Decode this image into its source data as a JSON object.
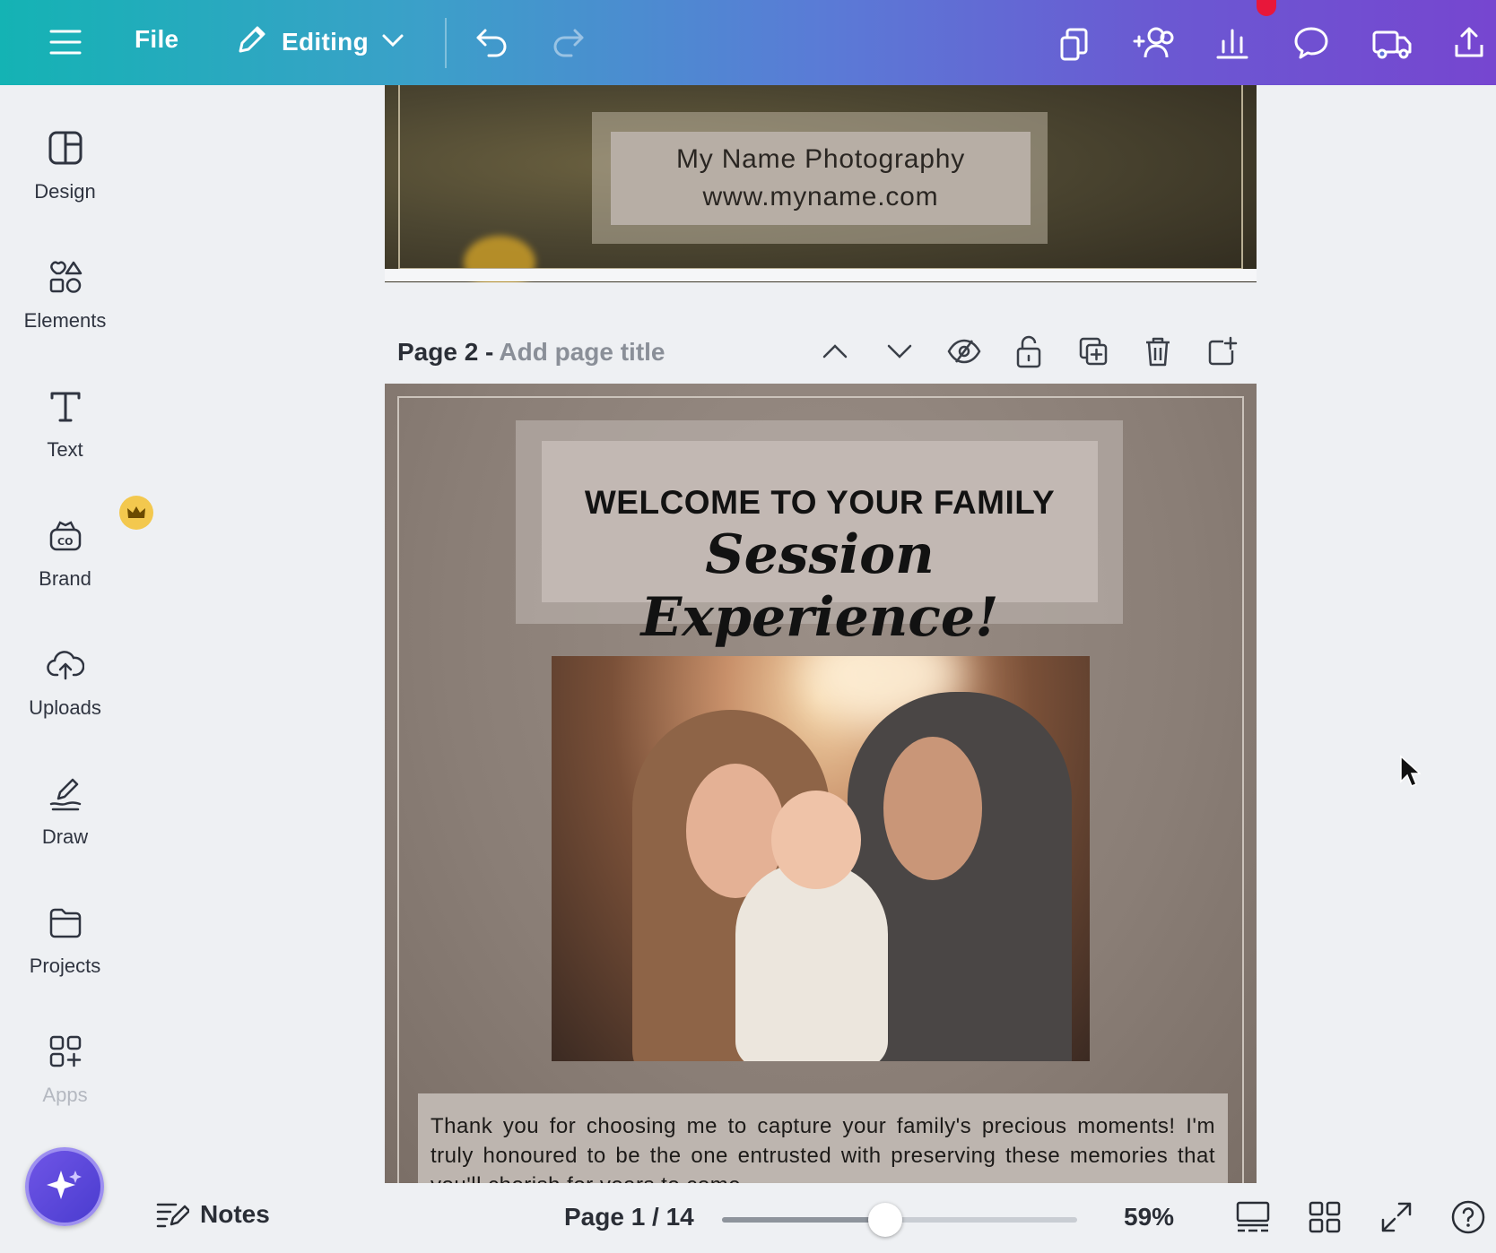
{
  "topbar": {
    "file_label": "File",
    "mode_label": "Editing",
    "icons": [
      "menu-icon",
      "pencil-icon",
      "chevron-down-icon",
      "undo-icon",
      "redo-icon",
      "resize-icon",
      "share-people-icon",
      "insights-icon",
      "comment-icon",
      "print-truck-icon",
      "upload-share-icon"
    ],
    "notification_color": "#e8173a"
  },
  "sidebar": {
    "items": [
      {
        "label": "Design",
        "icon": "design-icon"
      },
      {
        "label": "Elements",
        "icon": "elements-icon"
      },
      {
        "label": "Text",
        "icon": "text-icon"
      },
      {
        "label": "Brand",
        "icon": "brand-icon"
      },
      {
        "label": "Uploads",
        "icon": "uploads-icon"
      },
      {
        "label": "Draw",
        "icon": "draw-icon"
      },
      {
        "label": "Projects",
        "icon": "projects-icon"
      },
      {
        "label": "Apps",
        "icon": "apps-icon"
      }
    ],
    "magic_icon": "sparkle-icon"
  },
  "canvas": {
    "page1": {
      "line1": "My Name Photography",
      "line2": "www.myname.com"
    },
    "page2_header": {
      "title": "Page 2 -",
      "subtitle": "Add page title",
      "icons": [
        "chevron-up-icon",
        "chevron-down-icon",
        "hide-icon",
        "lock-icon",
        "duplicate-icon",
        "trash-icon",
        "add-page-icon"
      ]
    },
    "page2": {
      "heading": "WELCOME TO YOUR FAMILY",
      "script_heading": "Session Experience!",
      "body": "Thank you for choosing me to capture your family's precious moments! I'm truly honoured to be the one entrusted with preserving these memories that you'll cherish for years to come."
    }
  },
  "bottombar": {
    "notes_label": "Notes",
    "page_indicator": "Page 1 / 14",
    "zoom_label": "59%",
    "zoom_fraction": 0.46
  }
}
